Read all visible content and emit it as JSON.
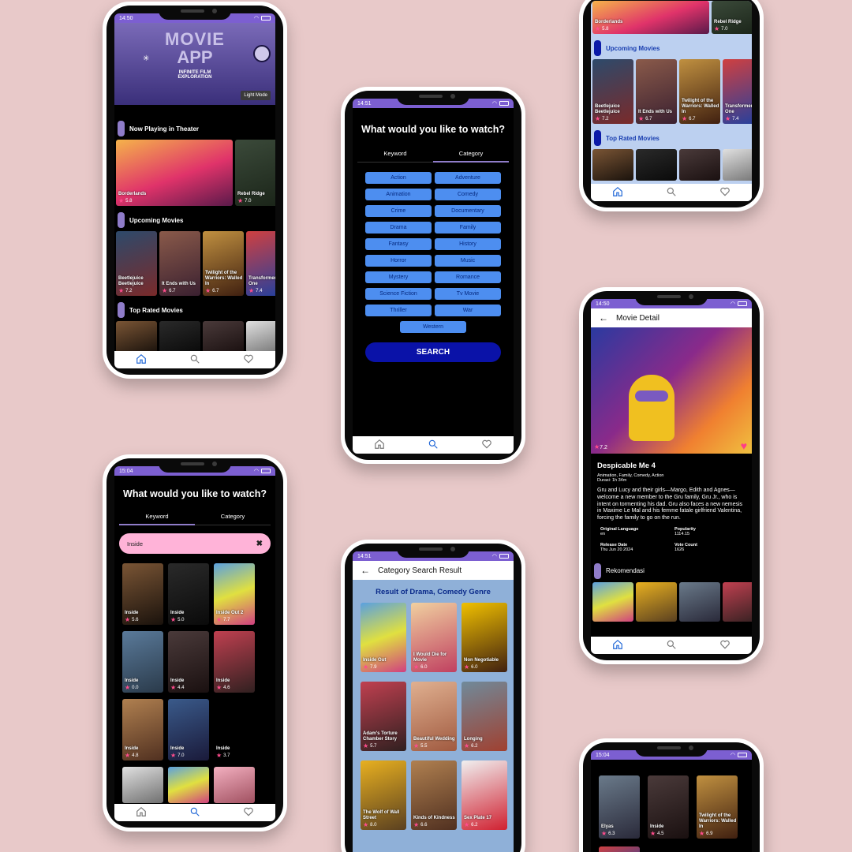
{
  "nav": {
    "home": "home-icon",
    "search": "search-icon",
    "favorites": "heart-icon"
  },
  "phone1": {
    "time": "14:50",
    "banner": {
      "title_line1": "MOVIE",
      "title_line2": "APP",
      "subtitle": "INFINITE FILM EXPLORATION",
      "mode_button": "Light Mode"
    },
    "now_playing": {
      "title": "Now Playing in Theater",
      "items": [
        {
          "title": "Borderlands",
          "rating": "5.8"
        },
        {
          "title": "Rebel Ridge",
          "rating": "7.0"
        }
      ]
    },
    "upcoming": {
      "title": "Upcoming Movies",
      "items": [
        {
          "title": "Beetlejuice Beetlejuice",
          "rating": "7.2"
        },
        {
          "title": "It Ends with Us",
          "rating": "6.7"
        },
        {
          "title": "Twilight of the Warriors: Walled In",
          "rating": "6.7"
        },
        {
          "title": "Transformers One",
          "rating": "7.4"
        }
      ]
    },
    "top_rated": {
      "title": "Top Rated Movies"
    }
  },
  "phone2": {
    "time": "14:51",
    "heading": "What would you like to watch?",
    "tabs": [
      "Keyword",
      "Category"
    ],
    "genres": [
      "Action",
      "Adventure",
      "Animation",
      "Comedy",
      "Crime",
      "Documentary",
      "Drama",
      "Family",
      "Fantasy",
      "History",
      "Horror",
      "Music",
      "Mystery",
      "Romance",
      "Science Fiction",
      "Tv Movie",
      "Thriller",
      "War",
      "Western"
    ],
    "search_button": "SEARCH"
  },
  "phone3": {
    "items_top": [
      {
        "title": "Borderlands",
        "rating": "5.8"
      },
      {
        "title": "Rebel Ridge",
        "rating": "7.0"
      }
    ],
    "upcoming": {
      "title": "Upcoming Movies",
      "items": [
        {
          "title": "Beetlejuice Beetlejuice",
          "rating": "7.2"
        },
        {
          "title": "It Ends with Us",
          "rating": "6.7"
        },
        {
          "title": "Twilight of the Warriors: Walled In",
          "rating": "6.7"
        },
        {
          "title": "Transformers One",
          "rating": "7.4"
        }
      ]
    },
    "top_rated": {
      "title": "Top Rated Movies"
    }
  },
  "phone4": {
    "time": "14:50",
    "appbar_title": "Movie Detail",
    "rating": "7.2",
    "title": "Despicable Me 4",
    "genres": "Animation, Family, Comedy, Action",
    "duration": "Durasi: 1h 34m",
    "overview": "Gru and Lucy and their girls—Margo, Edith and Agnes—welcome a new member to the Gru family, Gru Jr., who is intent on tormenting his dad. Gru also faces a new nemesis in Maxime Le Mal and his femme fatale girlfriend Valentina, forcing the family to go on the run.",
    "info": {
      "lang_label": "Original Language",
      "lang": "en",
      "pop_label": "Popularity",
      "pop": "1114.15",
      "release_label": "Release Date",
      "release": "Thu Jun 20 2024",
      "vote_label": "Vote Count",
      "vote": "1626"
    },
    "recommend": "Rekomendasi"
  },
  "phone5": {
    "time": "15:04",
    "heading": "What would you like to watch?",
    "tabs": [
      "Keyword",
      "Category"
    ],
    "query": "Inside",
    "results": [
      {
        "title": "Inside",
        "rating": "5.6"
      },
      {
        "title": "Inside",
        "rating": "5.0"
      },
      {
        "title": "Inside Out 2",
        "rating": "7.7"
      },
      {
        "title": "Inside",
        "rating": "0.0"
      },
      {
        "title": "Inside",
        "rating": "4.4"
      },
      {
        "title": "Inside",
        "rating": "4.6"
      },
      {
        "title": "Inside",
        "rating": "4.8"
      },
      {
        "title": "Inside",
        "rating": "7.0"
      },
      {
        "title": "Inside",
        "rating": "3.7"
      }
    ]
  },
  "phone6": {
    "time": "14:51",
    "appbar_title": "Category Search Result",
    "heading": "Result of Drama, Comedy Genre",
    "results": [
      {
        "title": "Inside Out",
        "rating": "7.9"
      },
      {
        "title": "I Would Die for Movie",
        "rating": "6.0"
      },
      {
        "title": "Non Negotiable",
        "rating": "6.0"
      },
      {
        "title": "Adam's Torture Chamber Story",
        "rating": "5.7"
      },
      {
        "title": "Beautiful Wedding",
        "rating": "5.5"
      },
      {
        "title": "Longing",
        "rating": "6.2"
      },
      {
        "title": "The Wolf of Wall Street",
        "rating": "8.0"
      },
      {
        "title": "Kinds of Kindness",
        "rating": "6.6"
      },
      {
        "title": "Sex Plate 17",
        "rating": "6.2"
      }
    ]
  },
  "phone7": {
    "time": "15:04",
    "results": [
      {
        "title": "Elyas",
        "rating": "6.3"
      },
      {
        "title": "Inside",
        "rating": "4.5"
      },
      {
        "title": "Twilight of the Warriors: Walled In",
        "rating": "6.9"
      }
    ]
  }
}
